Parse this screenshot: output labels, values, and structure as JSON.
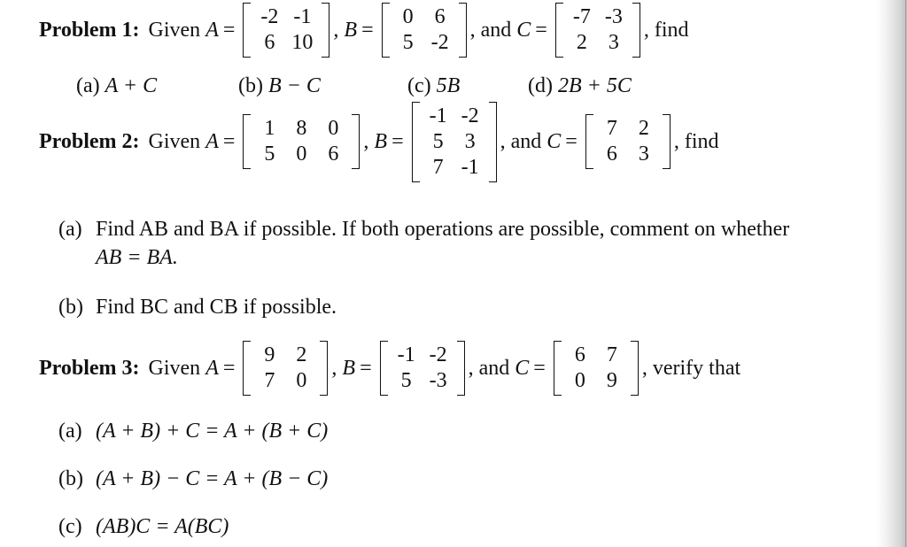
{
  "problem1": {
    "label": "Problem 1:",
    "given": "Given",
    "A": {
      "name": "A",
      "rows": [
        [
          "-2",
          "-1"
        ],
        [
          "6",
          "10"
        ]
      ]
    },
    "B": {
      "name": "B",
      "rows": [
        [
          "0",
          "6"
        ],
        [
          "5",
          "-2"
        ]
      ]
    },
    "C": {
      "name": "C",
      "rows": [
        [
          "-7",
          "-3"
        ],
        [
          "2",
          "3"
        ]
      ]
    },
    "and": ", and",
    "tail": ", find",
    "parts": [
      {
        "label": "(a)",
        "expr": "A + C"
      },
      {
        "label": "(b)",
        "expr": "B − C"
      },
      {
        "label": "(c)",
        "expr": "5B"
      },
      {
        "label": "(d)",
        "expr": "2B + 5C"
      }
    ]
  },
  "problem2": {
    "label": "Problem 2:",
    "given": "Given",
    "A": {
      "name": "A",
      "rows": [
        [
          "1",
          "8",
          "0"
        ],
        [
          "5",
          "0",
          "6"
        ]
      ]
    },
    "B": {
      "name": "B",
      "rows": [
        [
          "-1",
          "-2"
        ],
        [
          "5",
          "3"
        ],
        [
          "7",
          "-1"
        ]
      ]
    },
    "C": {
      "name": "C",
      "rows": [
        [
          "7",
          "2"
        ],
        [
          "6",
          "3"
        ]
      ]
    },
    "and": ", and",
    "tail": ", find",
    "parts": [
      {
        "label": "(a)",
        "text_line1": "Find AB and BA if possible. If both operations are possible, comment on whether",
        "text_line2": "AB = BA."
      },
      {
        "label": "(b)",
        "text_line1": "Find BC and CB if possible."
      }
    ]
  },
  "problem3": {
    "label": "Problem 3:",
    "given": "Given",
    "A": {
      "name": "A",
      "rows": [
        [
          "9",
          "2"
        ],
        [
          "7",
          "0"
        ]
      ]
    },
    "B": {
      "name": "B",
      "rows": [
        [
          "-1",
          "-2"
        ],
        [
          "5",
          "-3"
        ]
      ]
    },
    "C": {
      "name": "C",
      "rows": [
        [
          "6",
          "7"
        ],
        [
          "0",
          "9"
        ]
      ]
    },
    "and": ", and",
    "tail": ", verify that",
    "parts": [
      {
        "label": "(a)",
        "expr": "(A + B) + C = A + (B + C)"
      },
      {
        "label": "(b)",
        "expr": "(A + B) − C = A + (B − C)"
      },
      {
        "label": "(c)",
        "expr": "(AB)C = A(BC)"
      }
    ]
  }
}
